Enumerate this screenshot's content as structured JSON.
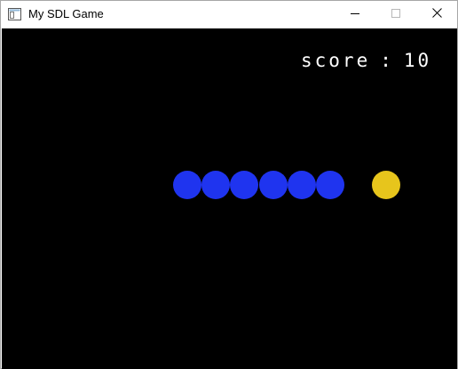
{
  "window": {
    "title": "My SDL Game"
  },
  "icons": {
    "app": "window-app-icon",
    "minimize": "minimize-icon",
    "maximize": "maximize-icon",
    "close": "close-icon"
  },
  "game": {
    "background": "#000000",
    "score_label": "score",
    "score_separator": ":",
    "score_value": "10",
    "snake_color": "#1f34ef",
    "food_color": "#e7c51c",
    "snake_segments": 6,
    "food_count": 1
  }
}
